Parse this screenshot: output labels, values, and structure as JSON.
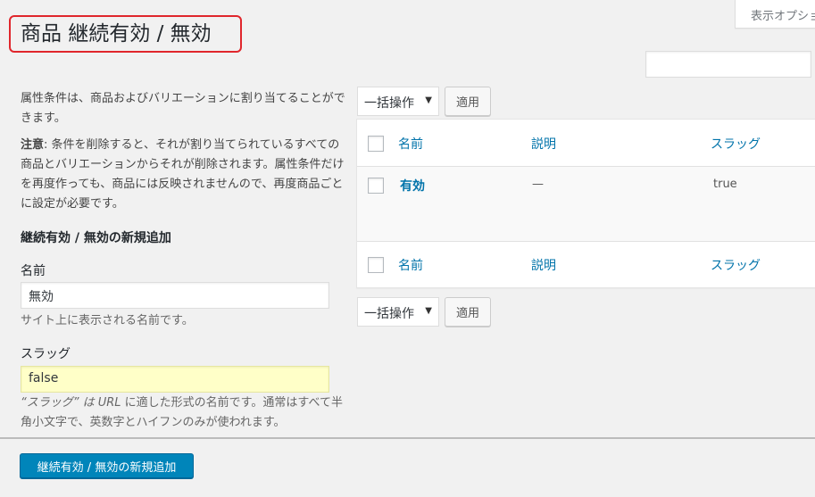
{
  "screen_options": {
    "label": "表示オプション"
  },
  "page": {
    "title": "商品 継続有効 / 無効"
  },
  "search": {
    "value": ""
  },
  "description": {
    "intro": "属性条件は、商品およびバリエーションに割り当てることができます。",
    "note_label": "注意",
    "note_text": ": 条件を削除すると、それが割り当てられているすべての商品とバリエーションからそれが削除されます。属性条件だけを再度作っても、商品には反映されませんので、再度商品ごとに設定が必要です。"
  },
  "form": {
    "heading": "継続有効 / 無効の新規追加",
    "name_label": "名前",
    "name_value": "無効",
    "name_help": "サイト上に表示される名前です。",
    "slug_label": "スラッグ",
    "slug_value": "false",
    "slug_help_1": "“スラッグ” は ",
    "slug_help_url": "URL",
    "slug_help_2": " に適した形式の名前です。通常はすべて半角小文字で、英数字とハイフンのみが使われます。",
    "submit_label": "継続有効 / 無効の新規追加"
  },
  "bulk": {
    "top": {
      "select": "一括操作",
      "apply": "適用"
    },
    "bottom": {
      "select": "一括操作",
      "apply": "適用"
    }
  },
  "table": {
    "columns": {
      "name": "名前",
      "description": "説明",
      "slug": "スラッグ"
    },
    "rows": [
      {
        "name": "有効",
        "description": "—",
        "slug": "true"
      }
    ]
  },
  "colors": {
    "primary": "#0085ba",
    "link": "#0073aa",
    "highlight_outline": "#e0262c",
    "slug_bg": "#ffffc8"
  }
}
